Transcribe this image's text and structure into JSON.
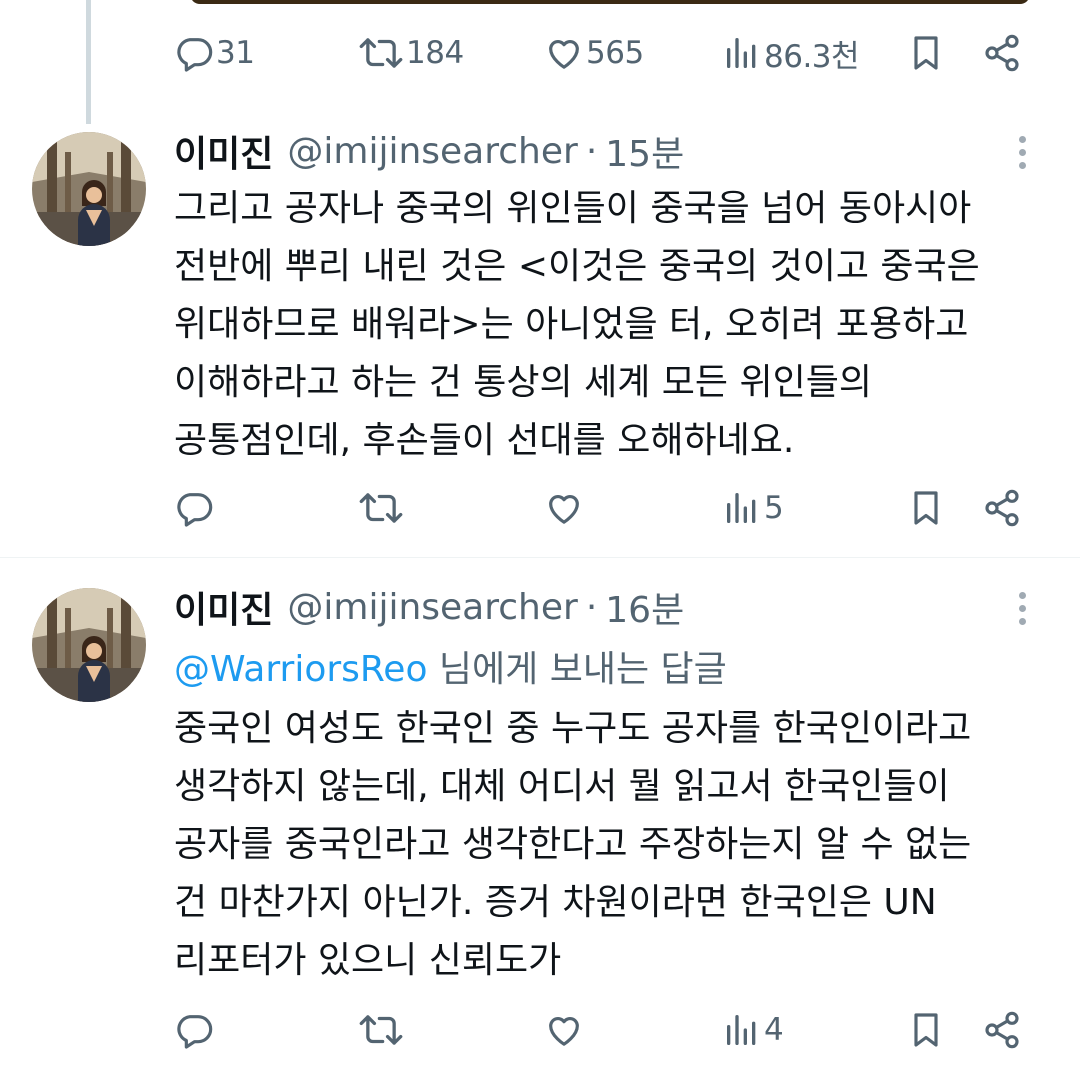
{
  "top_tweet": {
    "actions": {
      "replies": "31",
      "retweets": "184",
      "likes": "565",
      "views": "86.3천"
    }
  },
  "tweets": [
    {
      "name": "이미진",
      "handle": "@imijinsearcher",
      "separator": "·",
      "time": "15분",
      "lines": [
        "그리고 공자나 중국의 위인들이 중국을 넘어 동아시아",
        "전반에 뿌리 내린 것은 <이것은 중국의 것이고 중국은",
        "위대하므로 배워라>는 아니었을 터, 오히려 포용하고",
        "이해하라고 하는 건 통상의 세계 모든 위인들의",
        "공통점인데, 후손들이 선대를 오해하네요."
      ],
      "actions": {
        "views": "5"
      }
    },
    {
      "name": "이미진",
      "handle": "@imijinsearcher",
      "separator": "·",
      "time": "16분",
      "reply_to": {
        "mention": "@WarriorsReo",
        "suffix": " 님에게 보내는 답글"
      },
      "lines": [
        "중국인 여성도 한국인 중 누구도 공자를 한국인이라고",
        "생각하지 않는데, 대체 어디서 뭘 읽고서 한국인들이",
        "공자를 중국인라고 생각한다고 주장하는지 알 수 없는",
        "건 마찬가지 아닌가. 증거 차원이라면 한국인은 UN",
        "리포터가 있으니 신뢰도가"
      ],
      "actions": {
        "views": "4"
      }
    }
  ],
  "colors": {
    "text": "#0f1419",
    "muted": "#536471",
    "link": "#1d9bf0",
    "divider": "#eff3f4",
    "thread_line": "#cfd9de"
  },
  "icons": [
    "reply-icon",
    "retweet-icon",
    "like-icon",
    "views-icon",
    "bookmark-icon",
    "share-icon",
    "more-icon"
  ]
}
